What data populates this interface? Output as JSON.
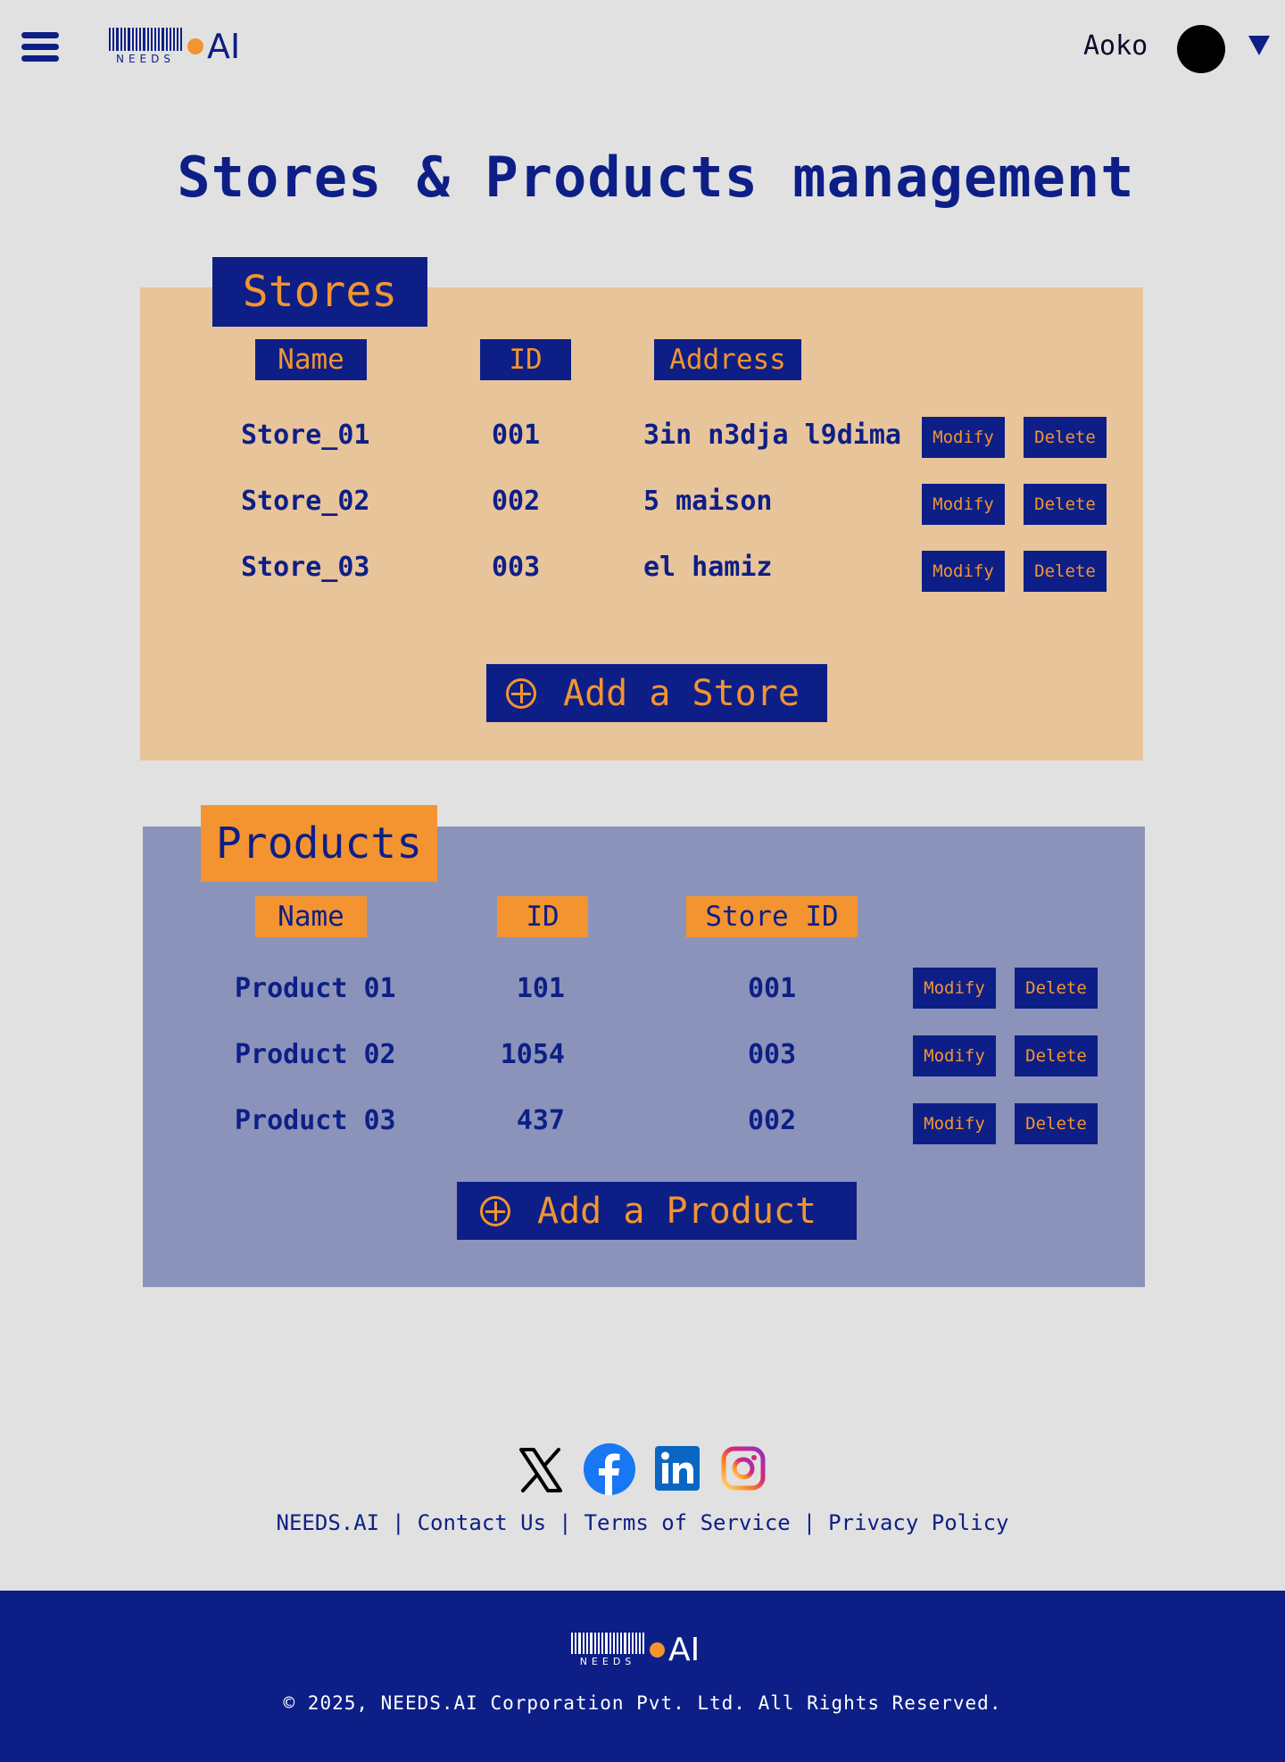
{
  "header": {
    "logo_text": "NEEDS",
    "logo_ai": "AI",
    "username": "Aoko"
  },
  "page_title": "Stores & Products management",
  "stores": {
    "tab_label": "Stores",
    "columns": [
      "Name",
      "ID",
      "Address"
    ],
    "rows": [
      {
        "name": "Store_01",
        "id": "001",
        "address": "3in n3dja l9dima"
      },
      {
        "name": "Store_02",
        "id": "002",
        "address": "5 maison"
      },
      {
        "name": "Store_03",
        "id": "003",
        "address": "el hamiz"
      }
    ],
    "modify_label": "Modify",
    "delete_label": "Delete",
    "add_label": "Add a Store"
  },
  "products": {
    "tab_label": "Products",
    "columns": [
      "Name",
      "ID",
      "Store ID"
    ],
    "rows": [
      {
        "name": "Product 01",
        "id": "101",
        "store_id": "001"
      },
      {
        "name": "Product 02",
        "id": "1054",
        "store_id": "003"
      },
      {
        "name": "Product 03",
        "id": "437",
        "store_id": "002"
      }
    ],
    "modify_label": "Modify",
    "delete_label": "Delete",
    "add_label": "Add a Product"
  },
  "footer": {
    "social_icons": [
      "x-icon",
      "facebook-icon",
      "linkedin-icon",
      "instagram-icon"
    ],
    "links": [
      "NEEDS.AI",
      "Contact Us",
      "Terms of Service",
      "Privacy Policy"
    ],
    "separator": "|",
    "copyright": "© 2025, NEEDS.AI Corporation Pvt. Ltd. All Rights Reserved."
  },
  "colors": {
    "navy": "#0d1f86",
    "orange": "#f39431",
    "stores_panel": "#e8c49b",
    "products_panel": "#8b93ba",
    "background": "#e1e1e1"
  }
}
